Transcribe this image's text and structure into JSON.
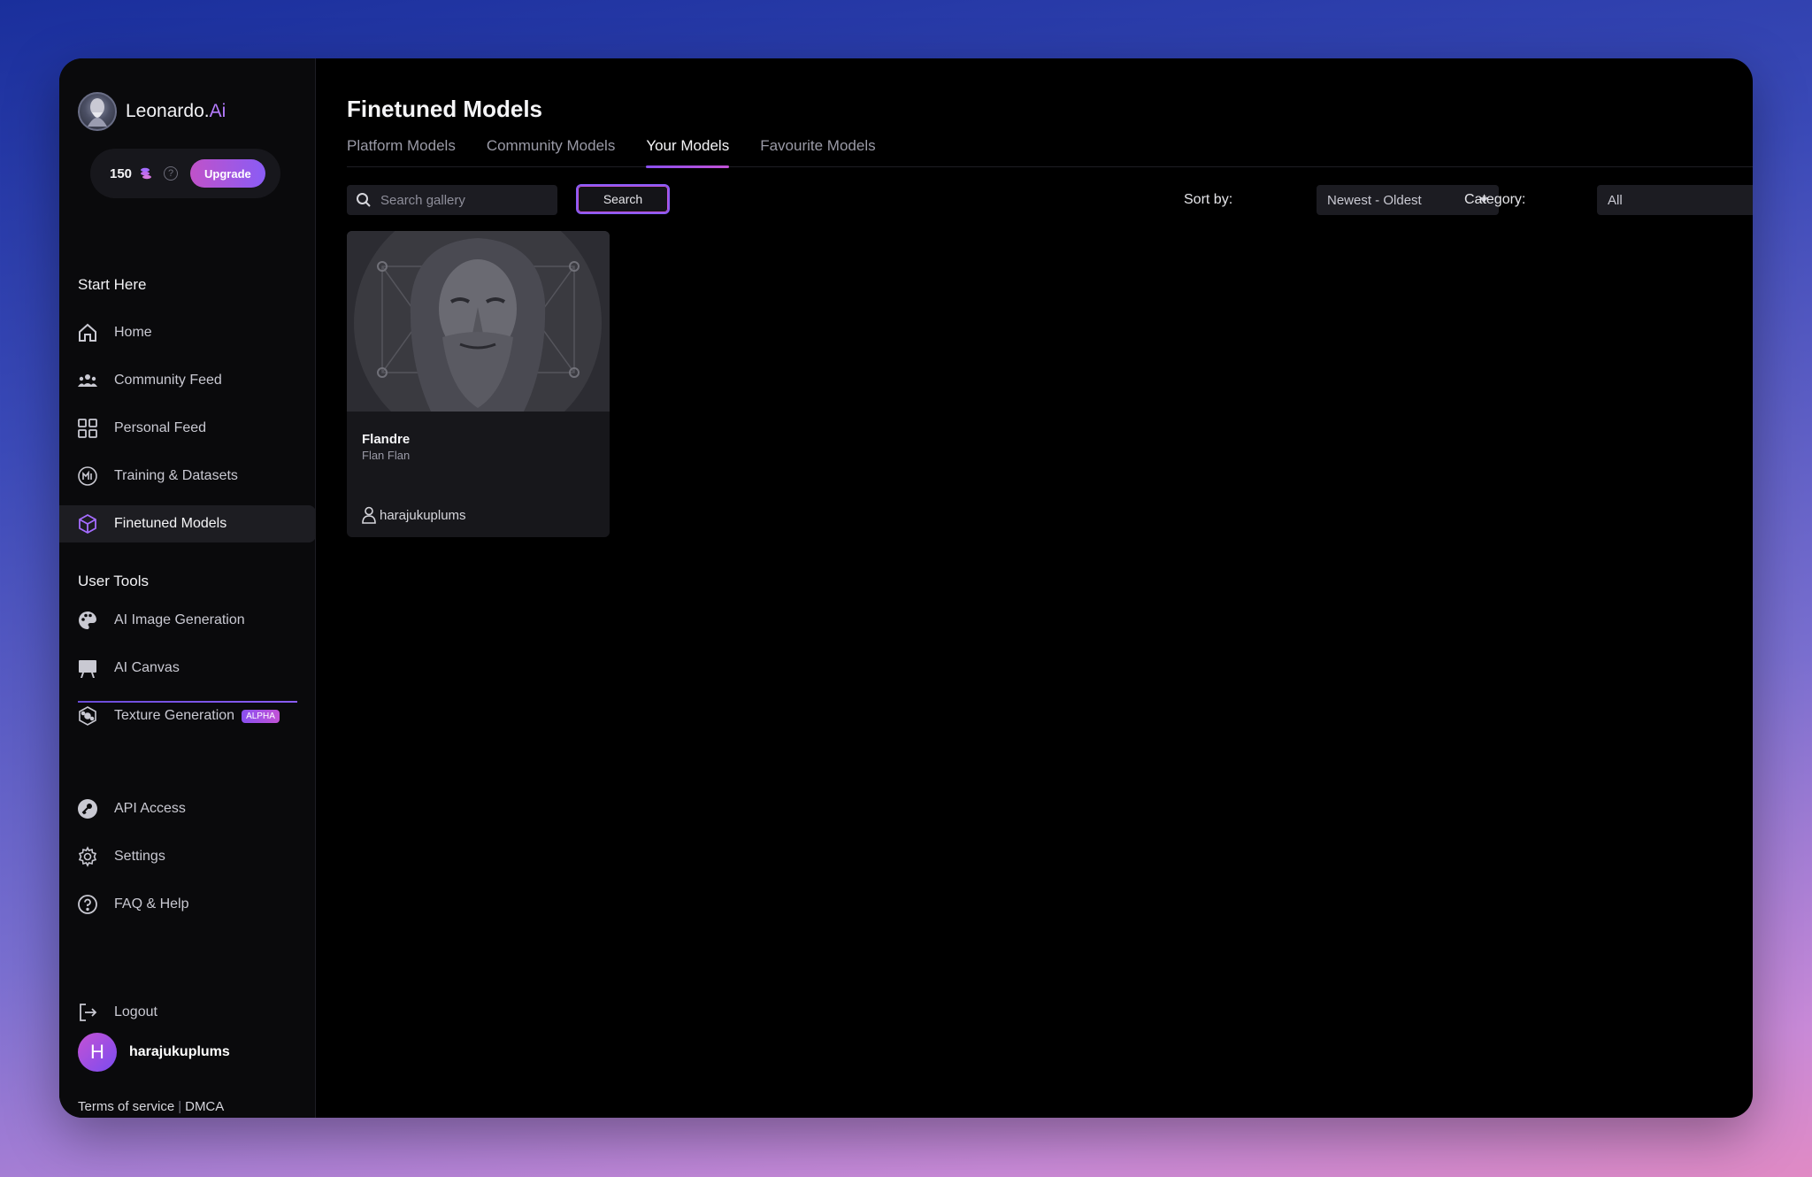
{
  "brand": {
    "name": "Leonardo.",
    "suffix": "Ai"
  },
  "credits": {
    "amount": "150",
    "upgrade_label": "Upgrade"
  },
  "sidebar": {
    "start_title": "Start Here",
    "start_items": [
      {
        "label": "Home",
        "icon": "home-icon"
      },
      {
        "label": "Community Feed",
        "icon": "community-icon"
      },
      {
        "label": "Personal Feed",
        "icon": "grid-icon"
      },
      {
        "label": "Training & Datasets",
        "icon": "training-icon"
      },
      {
        "label": "Finetuned Models",
        "icon": "cube-icon",
        "active": true
      }
    ],
    "tools_title": "User Tools",
    "tool_items": [
      {
        "label": "AI Image Generation",
        "icon": "palette-icon"
      },
      {
        "label": "AI Canvas",
        "icon": "canvas-icon"
      },
      {
        "label": "Texture Generation",
        "icon": "texture-icon",
        "badge": "ALPHA"
      }
    ],
    "bottom_items": [
      {
        "label": "API Access",
        "icon": "key-icon"
      },
      {
        "label": "Settings",
        "icon": "gear-icon"
      },
      {
        "label": "FAQ & Help",
        "icon": "help-icon"
      }
    ],
    "logout_label": "Logout",
    "user": {
      "initial": "H",
      "name": "harajukuplums"
    },
    "footer": {
      "terms": "Terms of service",
      "separator": "|",
      "dmca": "DMCA"
    },
    "social_icons": [
      "discord-icon",
      "reddit-icon",
      "x-icon",
      "facebook-icon",
      "apple-icon"
    ]
  },
  "main": {
    "title": "Finetuned Models",
    "tabs": [
      {
        "label": "Platform Models",
        "active": false
      },
      {
        "label": "Community Models",
        "active": false
      },
      {
        "label": "Your Models",
        "active": true
      },
      {
        "label": "Favourite Models",
        "active": false
      }
    ],
    "search": {
      "placeholder": "Search gallery",
      "value": "",
      "button_label": "Search"
    },
    "sort": {
      "label": "Sort by:",
      "value": "Newest - Oldest"
    },
    "category": {
      "label": "Category:",
      "value": "All"
    },
    "models": [
      {
        "name": "Flandre",
        "subtitle": "Flan Flan",
        "owner": "harajukuplums"
      }
    ]
  },
  "colors": {
    "accent": "#8a5cf5",
    "accent_pink": "#c252d6",
    "background": "#000000"
  }
}
